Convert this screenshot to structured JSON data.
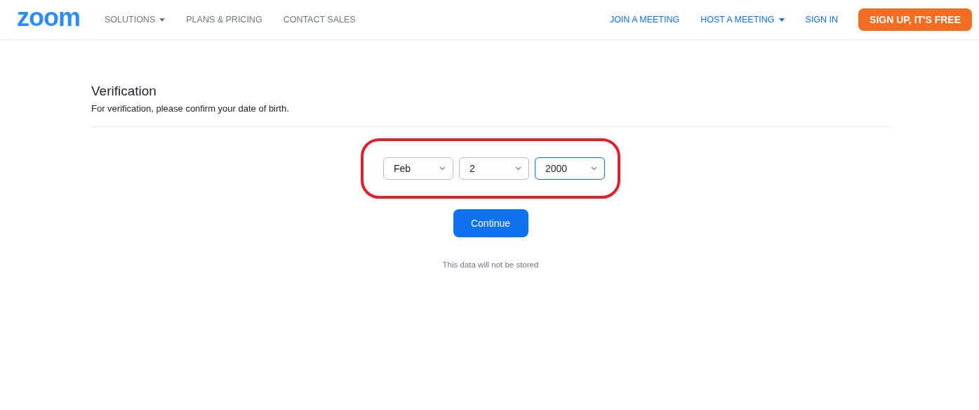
{
  "nav": {
    "logo": "zoom",
    "left_links": [
      {
        "label": "SOLUTIONS",
        "dropdown": true
      },
      {
        "label": "PLANS & PRICING",
        "dropdown": false
      },
      {
        "label": "CONTACT SALES",
        "dropdown": false
      }
    ],
    "right_links": [
      {
        "label": "JOIN A MEETING",
        "dropdown": false
      },
      {
        "label": "HOST A MEETING",
        "dropdown": true
      },
      {
        "label": "SIGN IN",
        "dropdown": false
      }
    ],
    "signup_button": "SIGN UP, IT'S FREE"
  },
  "verification": {
    "title": "Verification",
    "subtitle": "For verification, please confirm your date of birth.",
    "highlighted": true,
    "selects": [
      {
        "value": "Feb",
        "focused": false
      },
      {
        "value": "2",
        "focused": false
      },
      {
        "value": "2000",
        "focused": true
      }
    ],
    "button": "Continue",
    "note": "This data will not be stored"
  }
}
